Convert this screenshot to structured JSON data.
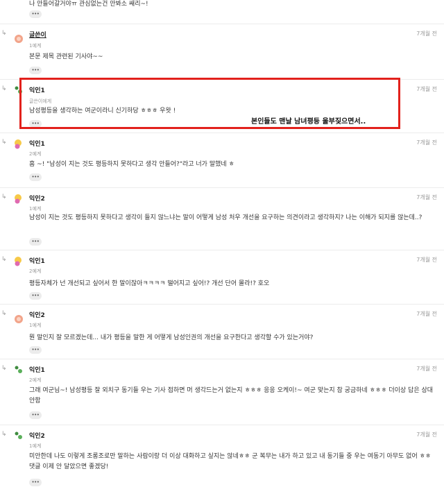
{
  "top_fragment": {
    "text": "나 안들어갈거야ㅠ 관심없는건 안봐소 쌔리~!",
    "more_label": "•••"
  },
  "annotation": "본인들도 맨날 남녀평등 울부짖으면서..",
  "comments": [
    {
      "author": "글쓴이",
      "meta": "1예계",
      "time": "7개월 전",
      "body": "본문 제목 관련된 기사야~~",
      "more_label": "•••",
      "reply_icon": "↳"
    },
    {
      "author": "익인1",
      "meta": "글쓴이에게",
      "time": "7개월 전",
      "body": "남성평등을 생각하는 여군이라니 신기하당 ㅎㅎㅎ 우왓 !",
      "more_label": "•••",
      "reply_icon": "↳"
    },
    {
      "author": "익인1",
      "meta": "2예계",
      "time": "7개월 전",
      "body": "흠 ~! \"남성이 지는 것도 평등하지 못하다고 생각 안들어?\"라고 너가 말했네 ㅎ",
      "more_label": "•••",
      "reply_icon": "↳"
    },
    {
      "author": "익인2",
      "meta": "1예계",
      "time": "7개월 전",
      "body": "남성이 지는 것도 평등하지 못하다고 생각이 들지 않느냐는 말이 어떻게 남성 처우 개선을 요구하는 의견이라고 생각하지? 나는 이해가 되지를 않는데..?",
      "more_label": "•••",
      "reply_icon": "↳"
    },
    {
      "author": "익인1",
      "meta": "2예계",
      "time": "7개월 전",
      "body": "평등자체가 넌 개선되고 싶어서 한 말이잖아ㅋㅋㅋㅋ 떨어지고 싶어!? 개선 단어 몰라!? 호오",
      "more_label": "•••",
      "reply_icon": "↳"
    },
    {
      "author": "익인2",
      "meta": "1예계",
      "time": "7개월 전",
      "body": "뭔 말인지 잘 모르겠는데... 내가 평등을 말한 게 어떻게 남성인권의 개선을 요구한다고 생각할 수가 있는거야?",
      "more_label": "•••",
      "reply_icon": "↳"
    },
    {
      "author": "익인1",
      "meta": "2예계",
      "time": "7개월 전",
      "body": "그래 여군님~! 남성평등 잘 외치구 동기들 우는 기사 접하면 머 생각드는거 없는지 ㅎㅎㅎ 응응 오케이!~ 여군 맞는지 참 궁금하네 ㅎㅎㅎ 더이상 답은 상대안함",
      "more_label": "•••",
      "reply_icon": "↳"
    },
    {
      "author": "익인2",
      "meta": "1예계",
      "time": "7개월 전",
      "body": "미안한데 나도 이렇게 조롱조로만 말하는 사람이랑 더 이상 대화하고 싶지는 않네ㅎㅎ 군 복무는 내가 하고 있고 내 동기들 중 우는 여동기 아무도 없어 ㅎㅎ 댓글 이제 안 달았으면 좋겠당!",
      "more_label": "•••",
      "reply_icon": "↳"
    }
  ],
  "colors": {
    "highlight": "#e2211c",
    "divider": "#ececec",
    "meta": "#999999"
  }
}
